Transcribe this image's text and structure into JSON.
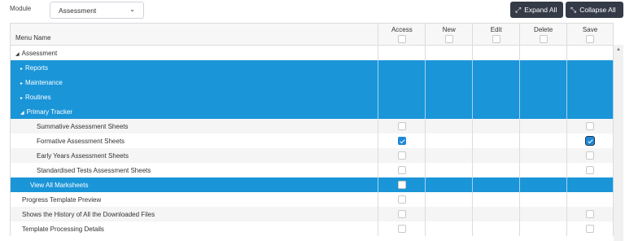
{
  "module": {
    "label": "Module",
    "selected": "Assessment"
  },
  "buttons": {
    "expand_label": "Expand All",
    "collapse_label": "Collapse All"
  },
  "columns": {
    "name": "Menu Name",
    "access": "Access",
    "new": "New",
    "edit": "Edit",
    "delete": "Delete",
    "save": "Save"
  },
  "rows": [
    {
      "label": "Assessment",
      "arrow": "◢",
      "style": "white"
    },
    {
      "label": "Reports",
      "arrow": "▸",
      "style": "blue"
    },
    {
      "label": "Maintenance",
      "arrow": "▸",
      "style": "blue"
    },
    {
      "label": "Routines",
      "arrow": "▸",
      "style": "blue"
    },
    {
      "label": "Primary Tracker",
      "arrow": "◢",
      "style": "blue"
    },
    {
      "label": "Summative Assessment Sheets",
      "style": "gray",
      "access": false,
      "save": false
    },
    {
      "label": "Formative Assessment Sheets",
      "style": "white",
      "access": true,
      "save": true
    },
    {
      "label": "Early Years Assessment Sheets",
      "style": "gray",
      "access": false,
      "save": false
    },
    {
      "label": "Standardised Tests Assessment Sheets",
      "style": "white",
      "access": false,
      "save": false
    },
    {
      "label": "View All Marksheets",
      "style": "blue",
      "access": false
    },
    {
      "label": "Progress Template Preview",
      "style": "white",
      "access": false
    },
    {
      "label": "Shows the History of All the Downloaded Files",
      "style": "gray",
      "access": false,
      "save": false
    },
    {
      "label": "Template Processing Details",
      "style": "white",
      "access": false,
      "save": false
    }
  ]
}
